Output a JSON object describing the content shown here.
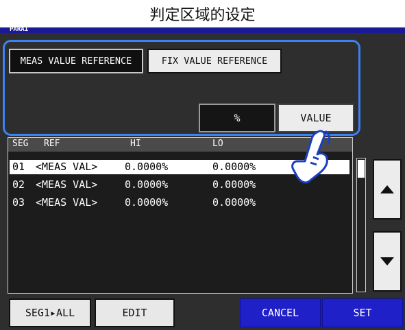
{
  "window": {
    "title": "判定区域的设定",
    "tag": "PARA1"
  },
  "reference": {
    "meas_label": "MEAS VALUE REFERENCE",
    "fix_label": "FIX VALUE REFERENCE",
    "selected": "meas"
  },
  "mode": {
    "percent_label": "%",
    "value_label": "VALUE",
    "selected": "percent"
  },
  "table": {
    "columns": [
      "SEG",
      "REF",
      "HI",
      "LO"
    ],
    "rows": [
      {
        "seg": "01",
        "ref": "<MEAS VAL>",
        "hi": "0.0000%",
        "lo": "0.0000%",
        "selected": true
      },
      {
        "seg": "02",
        "ref": "<MEAS VAL>",
        "hi": "0.0000%",
        "lo": "0.0000%",
        "selected": false
      },
      {
        "seg": "03",
        "ref": "<MEAS VAL>",
        "hi": "0.0000%",
        "lo": "0.0000%",
        "selected": false
      }
    ]
  },
  "buttons": {
    "seg_all": "SEG1▸ALL",
    "edit": "EDIT",
    "cancel": "CANCEL",
    "set": "SET"
  },
  "icons": {
    "up": "up-arrow-icon",
    "down": "down-arrow-icon",
    "hand": "pointing-hand-icon"
  },
  "colors": {
    "accent_blue": "#2020c8",
    "highlight": "#3b82f6",
    "panel": "#2e2e2e"
  }
}
